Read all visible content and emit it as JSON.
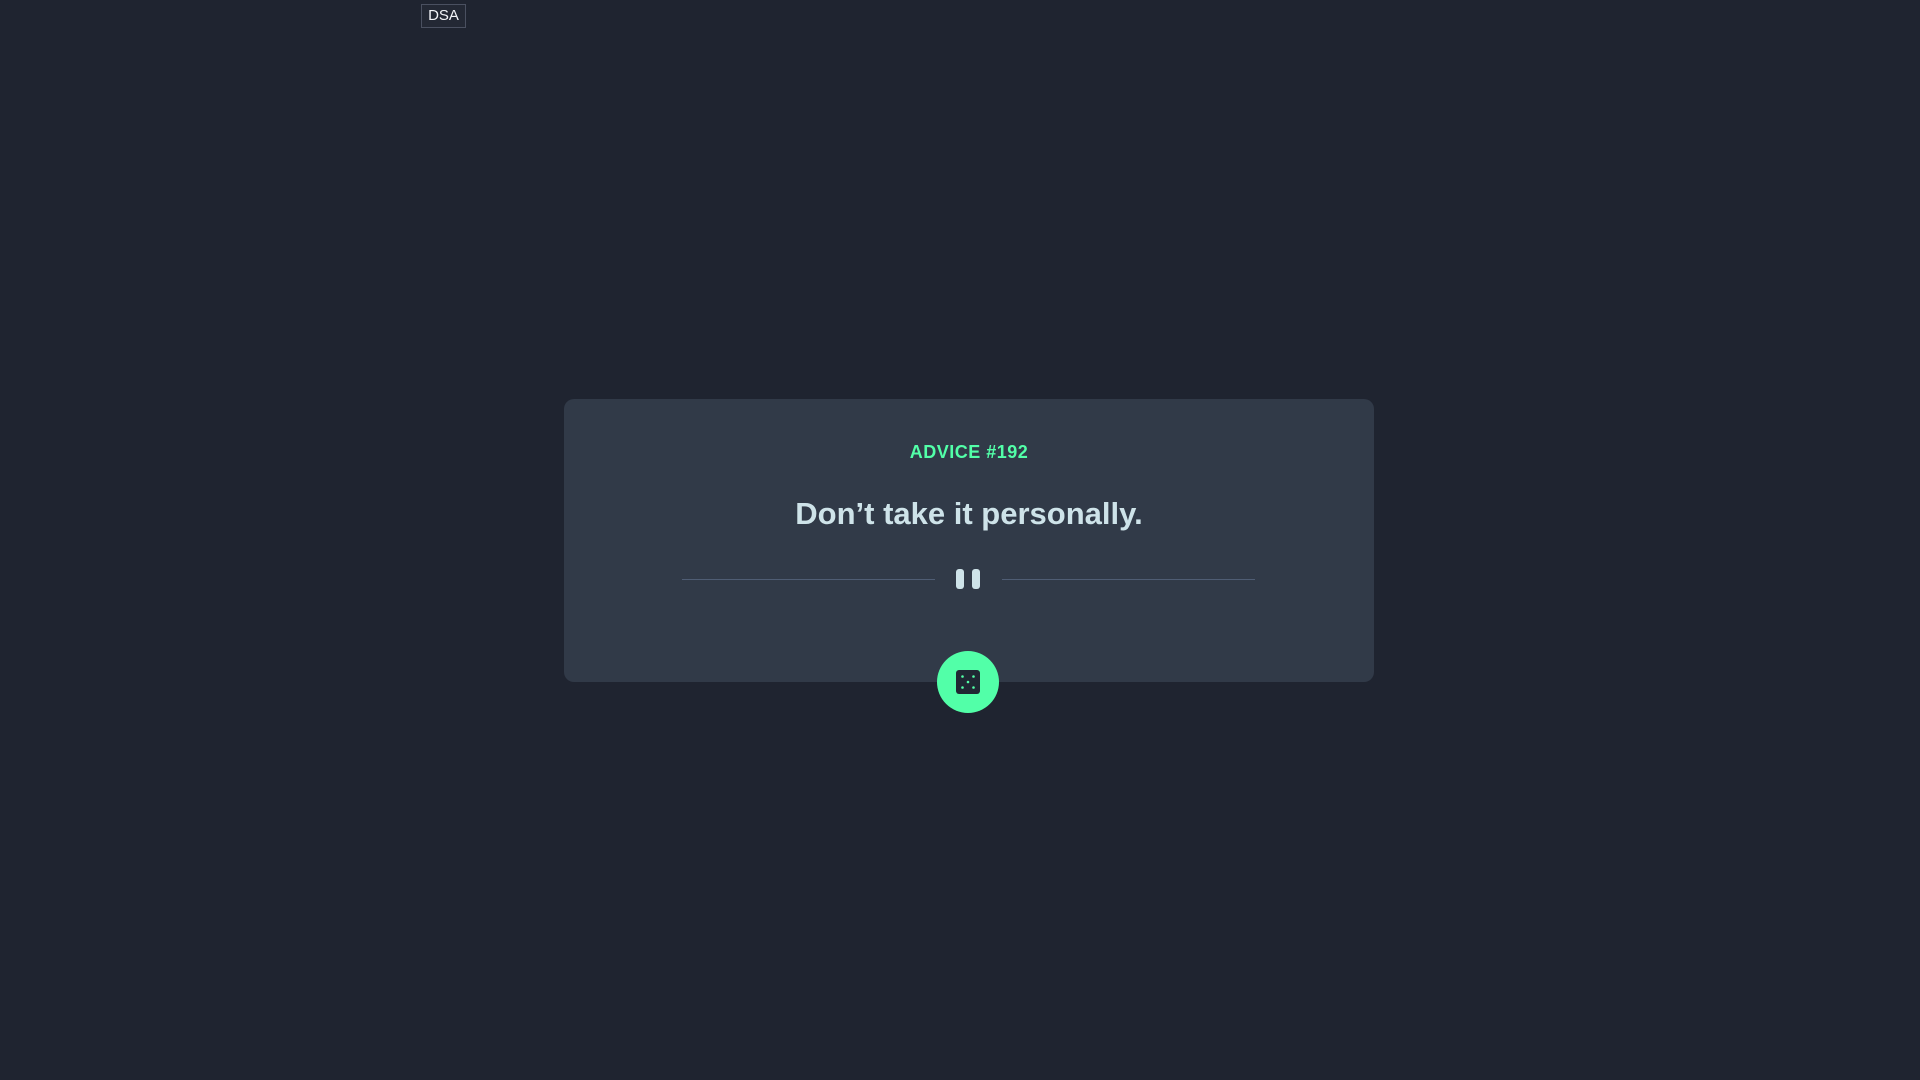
{
  "badge": {
    "label": "DSA"
  },
  "card": {
    "advice_id": "ADVICE #192",
    "advice_text": "Don’t take it personally."
  },
  "colors": {
    "background": "#1f2430",
    "card": "#313a48",
    "accent": "#52ffa8",
    "text": "#cee3e9",
    "divider": "#4f5d74"
  },
  "icons": {
    "divider": "pause-divider-icon",
    "button": "dice-icon"
  }
}
